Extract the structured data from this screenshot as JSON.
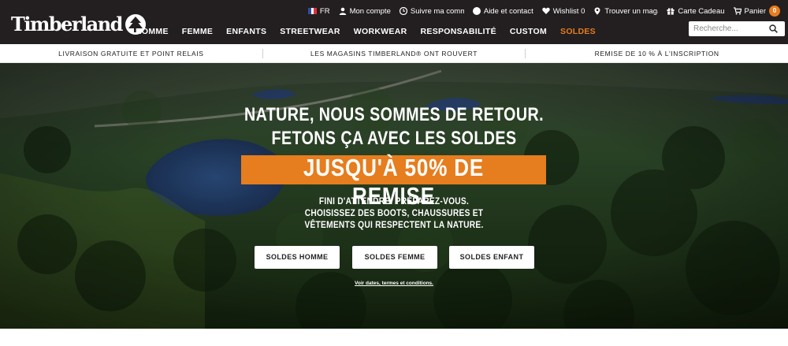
{
  "brand": {
    "name": "Timberland"
  },
  "utility": {
    "language": "FR",
    "account": "Mon compte",
    "track": "Suivre ma commande",
    "help": "Aide et contact",
    "wishlist": "Wishlist 0",
    "stores": "Trouver un magasin",
    "giftcard": "Carte Cadeau",
    "cart": "Panier",
    "cart_count": "0"
  },
  "nav": {
    "items": [
      "HOMME",
      "FEMME",
      "ENFANTS",
      "STREETWEAR",
      "WORKWEAR",
      "RESPONSABILITÉ",
      "CUSTOM",
      "SOLDES"
    ]
  },
  "search": {
    "placeholder": "Recherche..."
  },
  "promo": {
    "left": "LIVRAISON GRATUITE ET POINT RELAIS",
    "center": "LES MAGASINS TIMBERLAND® ONT ROUVERT",
    "right": "REMISE DE 10 % À L'INSCRIPTION"
  },
  "hero": {
    "line1": "NATURE, NOUS SOMMES DE RETOUR.",
    "line2": "FETONS ÇA AVEC LES SOLDES",
    "highlight": "JUSQU'À 50% DE REMISE",
    "sub1": "FINI D'ATTENDRE. PRÉPAREZ-VOUS.",
    "sub2": "CHOISISSEZ DES BOOTS, CHAUSSURES ET",
    "sub3": "VÊTEMENTS QUI RESPECTENT LA NATURE.",
    "buttons": [
      "SOLDES HOMME",
      "SOLDES FEMME",
      "SOLDES ENFANT"
    ],
    "terms": "Voir dates, termes et conditions."
  },
  "colors": {
    "header": "#231f20",
    "accent": "#e67d1e"
  }
}
